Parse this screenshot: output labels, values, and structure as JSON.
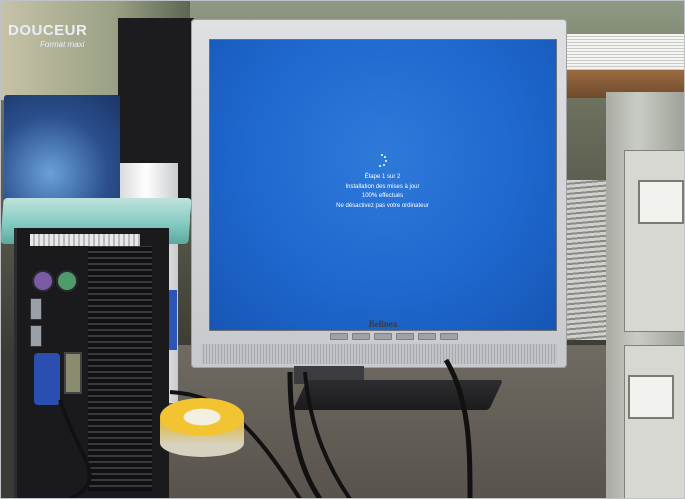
{
  "photo": {
    "tissue_box": {
      "brand": "DOUCEUR",
      "subtitle": "Format maxi"
    },
    "monitor": {
      "brand": "Belinea",
      "screen_color": "#1f68cf",
      "update_screen": {
        "line1": "Étape 1 sur 2",
        "line2": "Installation des mises à jour",
        "line3": "100% effectués",
        "line4": "Ne désactivez pas votre ordinateur"
      }
    },
    "accent_colors": {
      "tape": "#f2c431",
      "vga_connector": "#2b4fb0",
      "ps2_mouse": "#4f9b6a",
      "ps2_keyboard": "#7b5aa6"
    }
  }
}
